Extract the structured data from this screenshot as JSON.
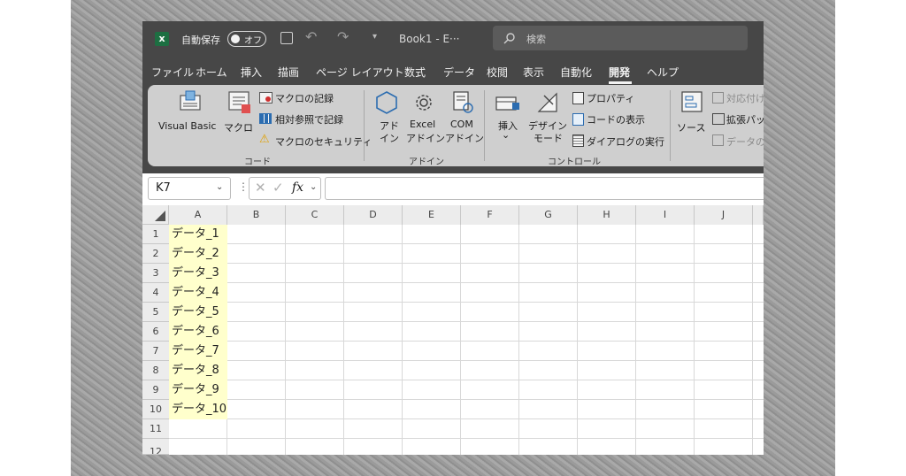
{
  "titlebar": {
    "app_icon": "excel-icon",
    "autosave_label": "自動保存",
    "autosave_toggle": "オフ",
    "save_icon": "save-icon",
    "undo_icon": "undo-icon",
    "redo_icon": "redo-icon",
    "customize_icon": "chevron-down-icon",
    "title": "Book1 - E···",
    "search_placeholder": "検索",
    "search_icon": "search-icon"
  },
  "tabs": [
    "ファイル",
    "ホーム",
    "挿入",
    "描画",
    "ページ レイアウト",
    "数式",
    "データ",
    "校閲",
    "表示",
    "自動化",
    "開発",
    "ヘルプ"
  ],
  "active_tab": "開発",
  "ribbon": {
    "code": {
      "visual_basic": "Visual Basic",
      "macro": "マクロ",
      "record_macro": "マクロの記録",
      "relative_ref": "相対参照で記録",
      "macro_security": "マクロのセキュリティ",
      "group_label": "コード"
    },
    "addins": {
      "addin_line1": "アド",
      "addin_line2": "イン",
      "excel_line1": "Excel",
      "excel_line2": "アドイン",
      "com_line1": "COM",
      "com_line2": "アドイン",
      "group_label": "アドイン"
    },
    "controls": {
      "insert": "挿入",
      "insert_arrow": "⌄",
      "design_line1": "デザイン",
      "design_line2": "モード",
      "properties": "プロパティ",
      "view_code": "コードの表示",
      "run_dialog": "ダイアログの実行",
      "group_label": "コントロール"
    },
    "xml": {
      "source": "ソース",
      "map_props": "対応付け",
      "expansion": "拡張パッ",
      "refresh": "データの"
    }
  },
  "formula_bar": {
    "name_box": "K7",
    "fx": "fx"
  },
  "grid": {
    "columns": [
      "A",
      "B",
      "C",
      "D",
      "E",
      "F",
      "G",
      "H",
      "I",
      "J"
    ],
    "rows": [
      "1",
      "2",
      "3",
      "4",
      "5",
      "6",
      "7",
      "8",
      "9",
      "10",
      "11",
      "12"
    ],
    "cells": [
      "データ_1",
      "データ_2",
      "データ_3",
      "データ_4",
      "データ_5",
      "データ_6",
      "データ_7",
      "データ_8",
      "データ_9",
      "データ_10"
    ]
  },
  "colors": {
    "chrome": "#474747",
    "ribbon": "#cfcfcf",
    "highlight": "#ffffcc",
    "header": "#ececec",
    "gridline": "#d8d8d8",
    "excel_green": "#1d6f42"
  }
}
